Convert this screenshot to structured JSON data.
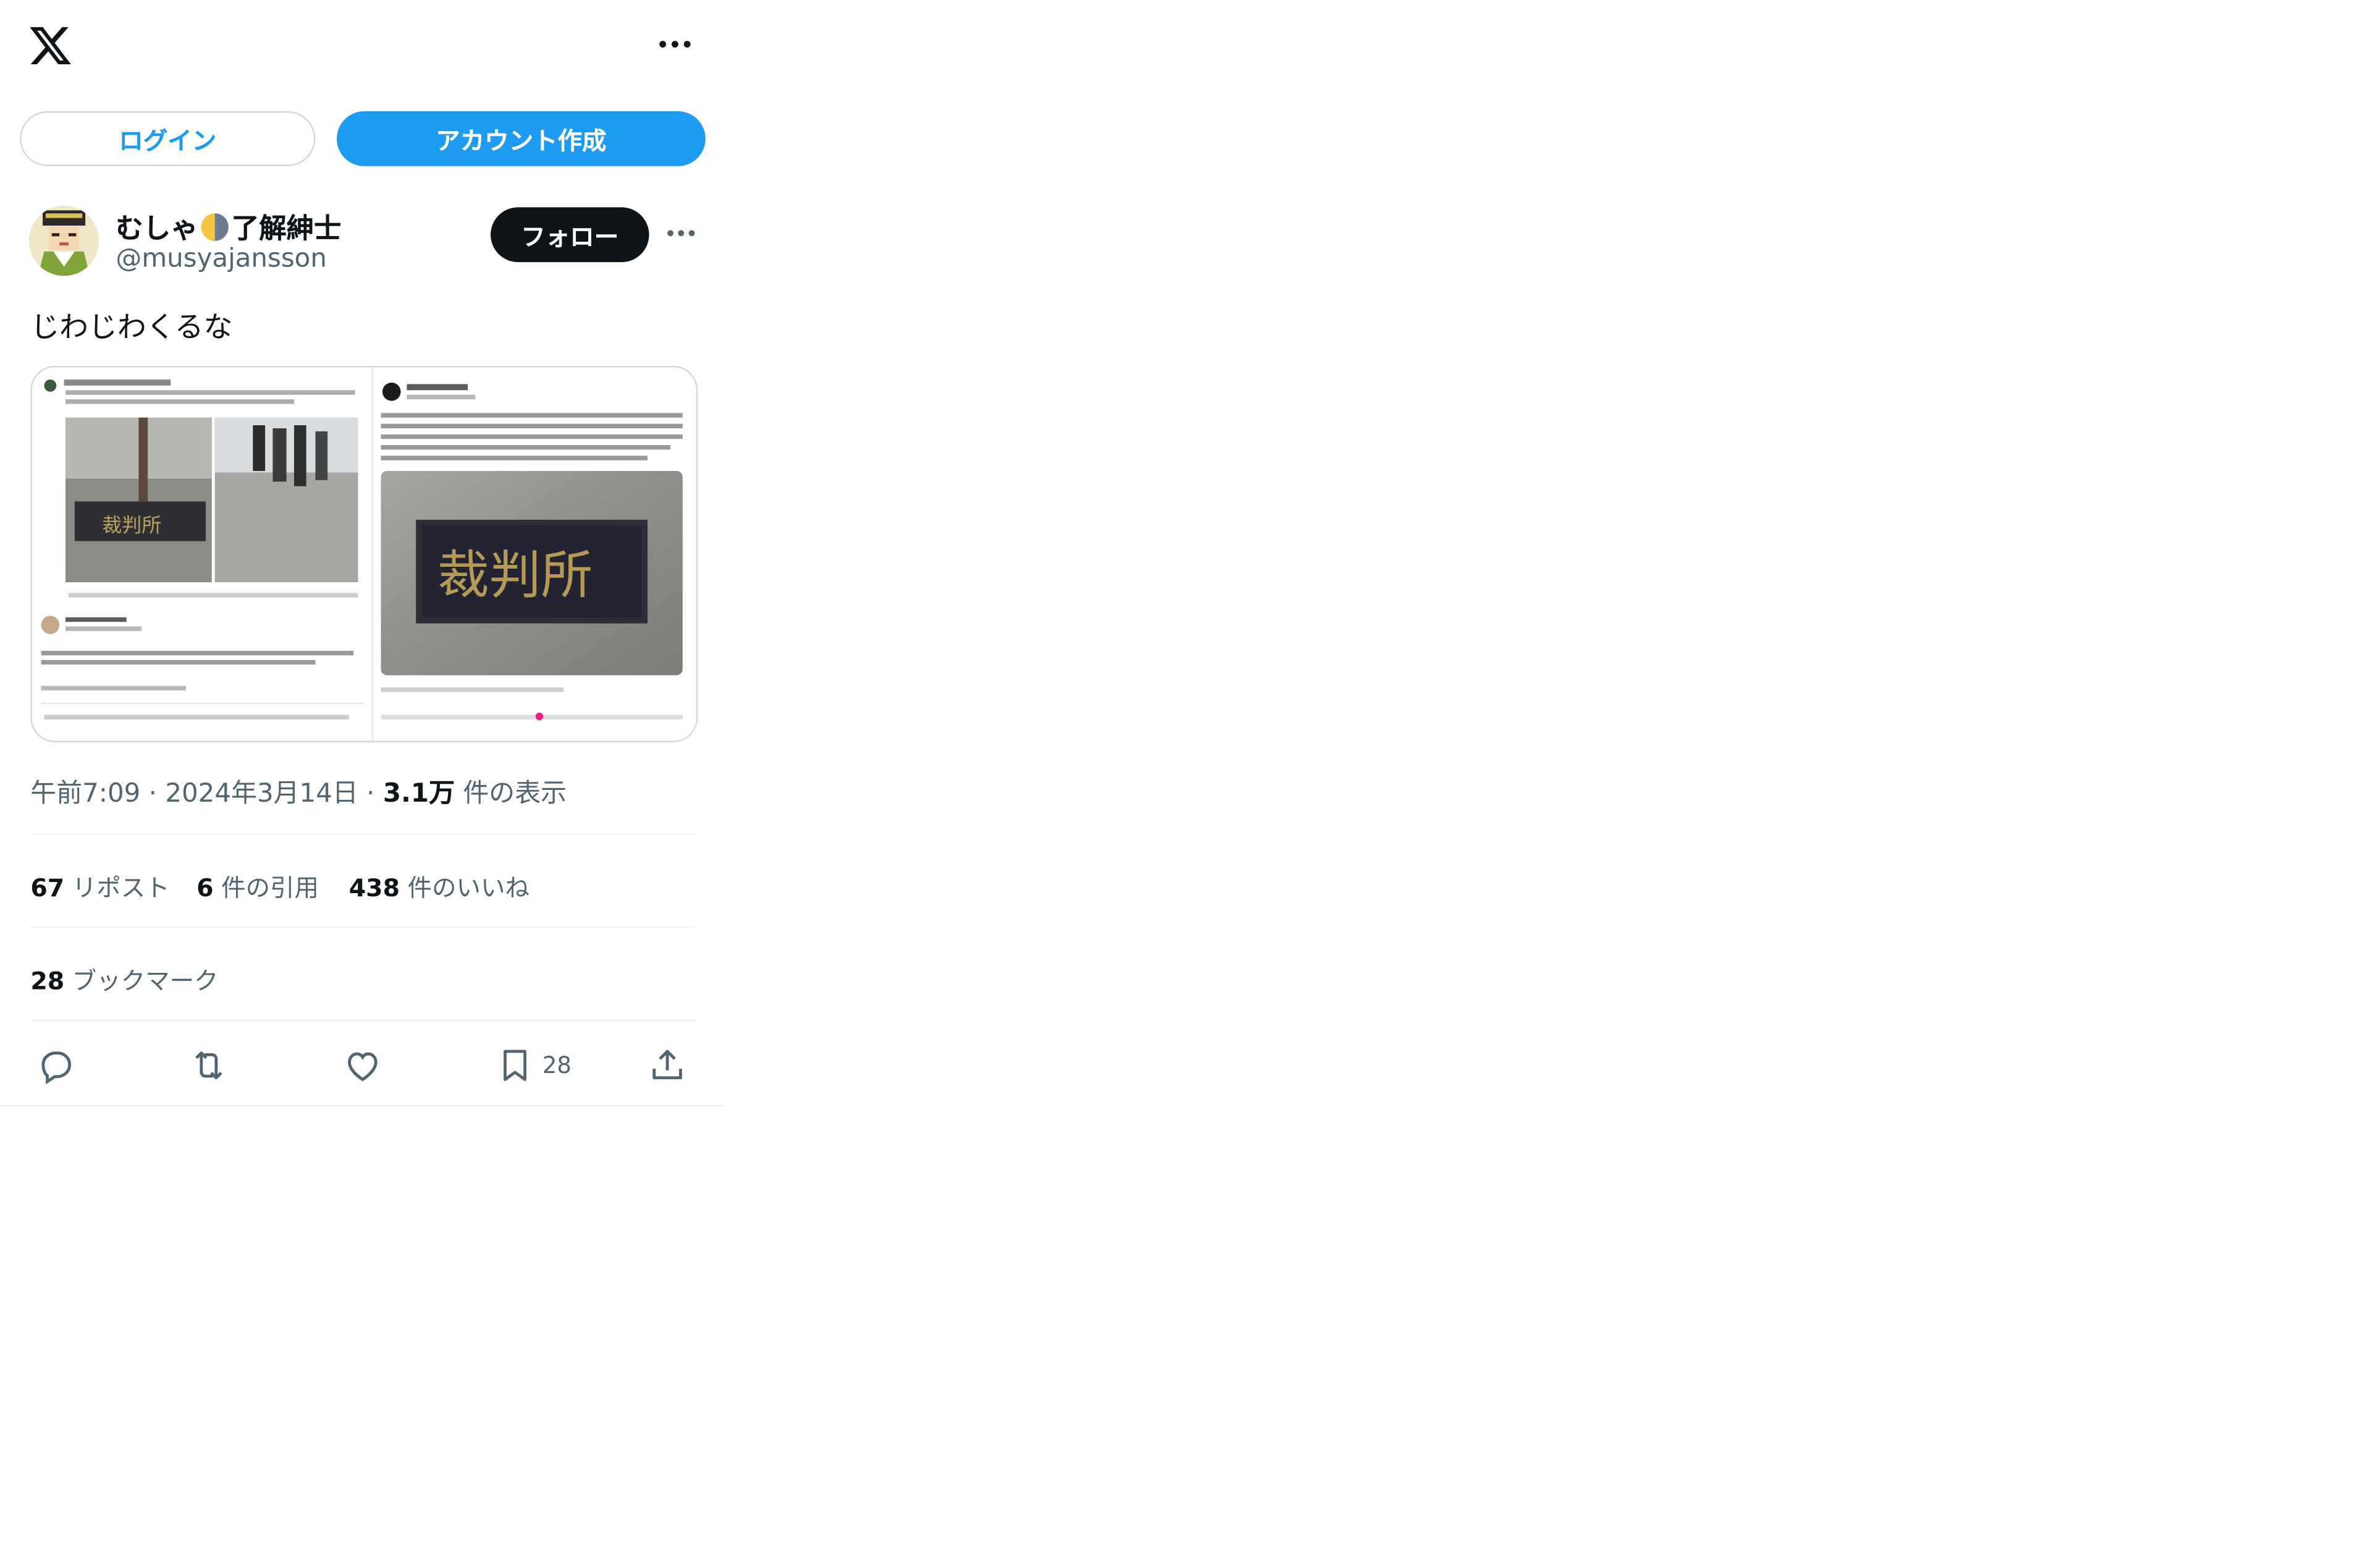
{
  "header": {
    "logo": "x-logo-icon",
    "more": "more-icon"
  },
  "auth": {
    "login_label": "ログイン",
    "signup_label": "アカウント作成"
  },
  "tweet": {
    "display_name_prefix": "むしゃ",
    "display_name_suffix": "了解紳士",
    "handle": "@musyajansson",
    "follow_label": "フォロー",
    "text": "じわじわくるな",
    "time": "午前7:09",
    "date": "2024年3月14日",
    "views_count": "3.1万",
    "views_label": " 件の表示",
    "reposts_count": "67",
    "reposts_label": " リポスト",
    "quotes_count": "6",
    "quotes_label": " 件の引用",
    "likes_count": "438",
    "likes_label": " 件のいいね",
    "bookmarks_count": "28",
    "bookmarks_label": " ブックマーク",
    "action_bookmark_count": "28"
  },
  "colors": {
    "accent": "#1d9bf0",
    "text": "#0f1419",
    "muted": "#536471",
    "border": "#cfd9de"
  }
}
